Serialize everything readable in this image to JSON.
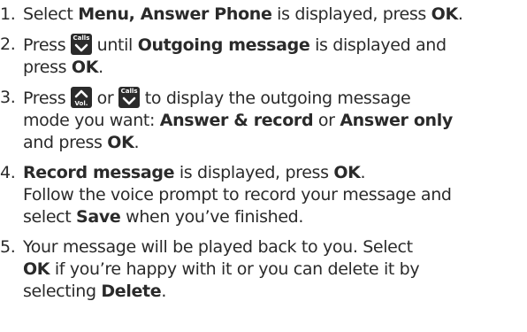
{
  "steps": [
    {
      "num": "1.",
      "t1": "Select ",
      "b1": "Menu, Answer Phone",
      "t2": " is displayed, press ",
      "b2": "OK",
      "t3": "."
    },
    {
      "num": "2.",
      "t1": "Press ",
      "t2": " until ",
      "b1": "Outgoing message",
      "t3": " is displayed and",
      "t4": "press ",
      "b2": "OK",
      "t5": "."
    },
    {
      "num": "3.",
      "t1": "Press ",
      "t2": " or ",
      "t3": " to display the outgoing message",
      "t4": "mode you want: ",
      "b1": "Answer & record",
      "t5": " or ",
      "b2": "Answer only",
      "t6": "and press ",
      "b3": "OK",
      "t7": "."
    },
    {
      "num": "4.",
      "b1": "Record message",
      "t1": " is displayed, press ",
      "b2": "OK",
      "t2": ".",
      "t3": "Follow the voice prompt to record your message and",
      "t4": "select ",
      "b3": "Save",
      "t5": " when you’ve finished."
    },
    {
      "num": "5.",
      "t1": "Your message will be played back to you. Select",
      "b1": "OK",
      "t2": " if you’re happy with it or you can delete it by",
      "t3": "selecting ",
      "b2": "Delete",
      "t4": "."
    }
  ],
  "keys": {
    "calls_label": "Calls",
    "vol_label": "Vol.",
    "calls_icon": "calls-down-arrow-icon",
    "vol_icon": "vol-up-arrow-icon"
  }
}
